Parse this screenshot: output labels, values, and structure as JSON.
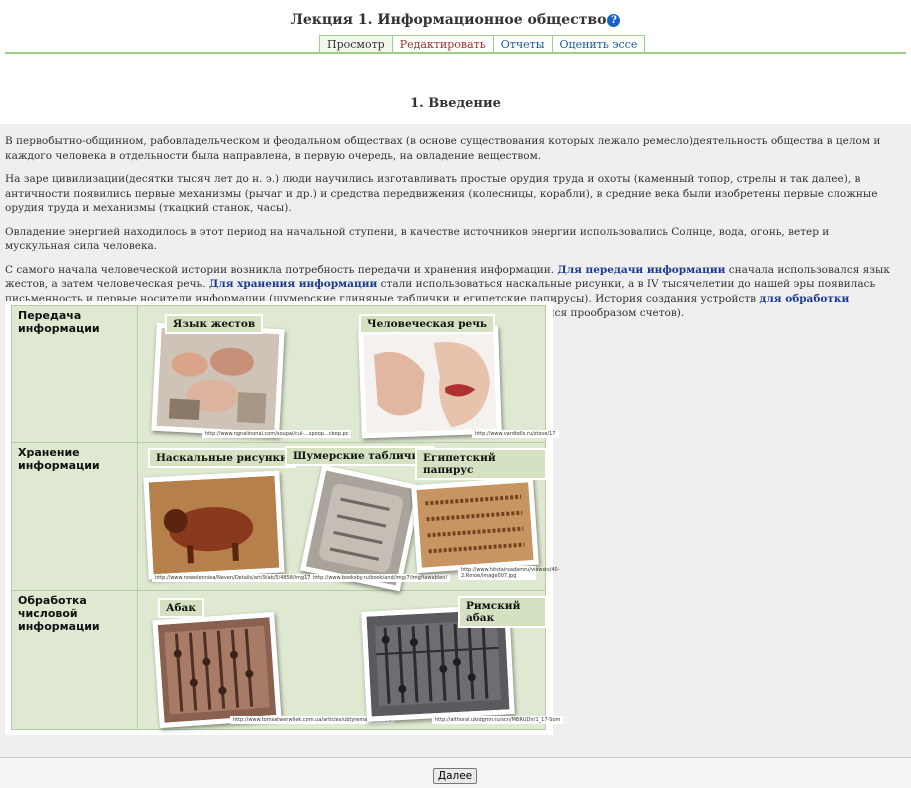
{
  "header": {
    "title": "Лекция 1. Информационное общество",
    "help_glyph": "?",
    "tabs": [
      {
        "label": "Просмотр",
        "active": true
      },
      {
        "label": "Редактировать"
      },
      {
        "label": "Отчеты"
      },
      {
        "label": "Оценить эссе"
      }
    ]
  },
  "section": {
    "title": "1. Введение"
  },
  "paragraphs": {
    "p1": "В первобытно-общинном, рабовладельческом и феодальном обществах (в основе существования которых лежало ремесло)деятельность общества в целом и каждого человека в отдельности была направлена, в первую очередь, на овладение веществом.",
    "p2": "На заре цивилизации(десятки тысяч лет до н. э.) люди научились изготавливать простые орудия труда и охоты (каменный топор, стрелы и так далее), в античности появились первые механизмы (рычаг и др.) и средства передвижения (колесницы, корабли), в средние века были изобретены первые сложные орудия труда и механизмы (ткацкий станок, часы).",
    "p3": "Овладение энергией находилось в этот период на начальной ступени, в качестве источников энергии использовались Солнце, вода, огонь, ветер и мускульная сила человека.",
    "p4": {
      "t1": "С самого начала человеческой истории возникла потребность передачи и хранения информации. ",
      "l1": "Для передачи информации",
      "t2": " сначала использовался язык жестов, а затем человеческая речь. ",
      "l2": "Для хранения информации",
      "t3": " стали использоваться наскальные рисунки, а в IV тысячелетии до нашей эры появилась письменность и первые носители информации (шумерские глиняные таблички и египетские папирусы). История создания устройств ",
      "l3": "для обработки числовой информации",
      "t4": " начинается также еще с древности — с абака (счетной доски,являющейся прообразом счетов)."
    }
  },
  "figure": {
    "rows": [
      {
        "label": "Передача информации"
      },
      {
        "label": "Хранение информации"
      },
      {
        "label": "Обработка числовой информации"
      }
    ],
    "items": {
      "gestures": {
        "label": "Язык жестов",
        "url": "http://www.ngnalinonal.com/soupai/cul-...spoop...cbop.pc"
      },
      "speech": {
        "label": "Человеческая  речь",
        "url": "http://www.vardtells.ru/stove/17"
      },
      "cave": {
        "label": "Наскальные  рисунки",
        "url": "http://www.nowolenniea/Neven/Details/art/9/ab/5/4858/img17/-txtypm"
      },
      "sumer": {
        "label": "Шумерские таблички",
        "url": "http://www.booksby.ru/book/and/img/7/img/tawablen/"
      },
      "papyrus": {
        "label": "Египетский папирус",
        "url": "http://www.hitstairsadamru/viewsts/40-2.Rmoe/image007.jpg"
      },
      "abacus": {
        "label": "Абак",
        "url": "http://www.tomsatwerwliek.com.ua/articles/ubtyremakta/156/1"
      },
      "roman": {
        "label": "Римский абак",
        "url": "http://althoral.ukidgmn.ru/scn/MBRUDir/1_17-Som"
      }
    }
  },
  "footer": {
    "next_label": "Далее"
  },
  "colors": {
    "tab_border": "#9fd07f",
    "figure_bg": "#dfe9d2",
    "link": "#1a3a8f",
    "help": "#1a63c4"
  }
}
